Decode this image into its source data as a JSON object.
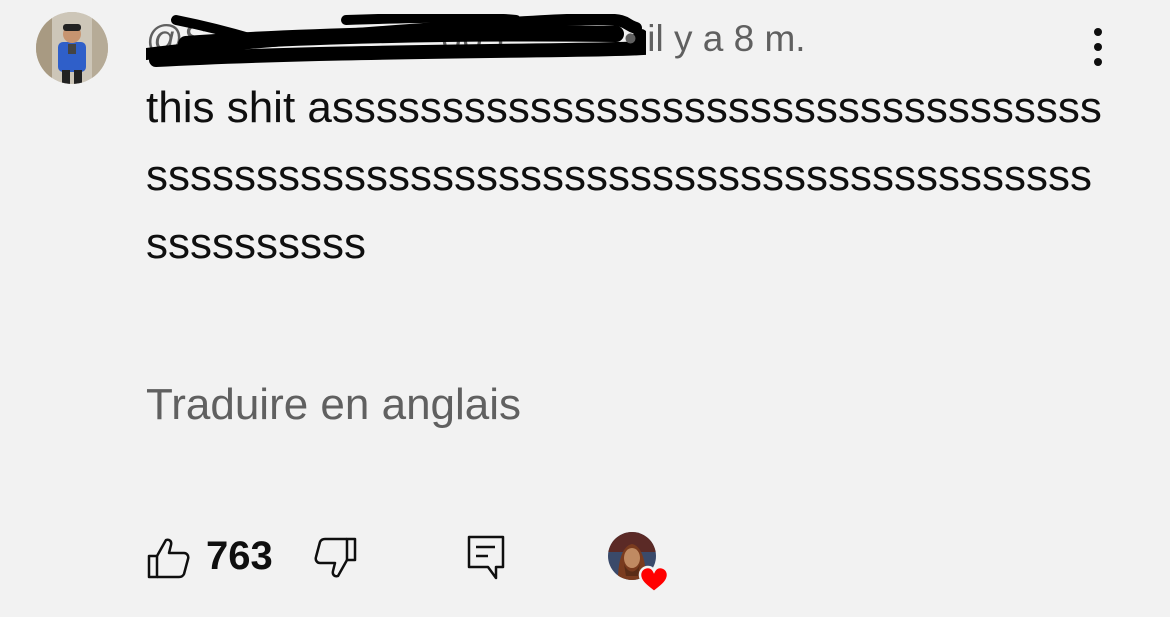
{
  "comment": {
    "handle": "@S___________005",
    "time": "• il y a 8 m.",
    "text": "this shit assssssssssssssssssssssssssssssssssssssssssssssssssssssssssssssssssssssssssssssssssssssss",
    "translate_label": "Traduire en anglais",
    "like_count": "763"
  },
  "icons": {
    "more": "more-vert-icon",
    "like": "thumb-up-icon",
    "dislike": "thumb-down-icon",
    "reply": "reply-comment-icon",
    "heart": "creator-heart-icon"
  },
  "colors": {
    "background": "#f2f2f2",
    "text_primary": "#0f0f0f",
    "text_secondary": "#606060",
    "heart": "#ff0000"
  }
}
